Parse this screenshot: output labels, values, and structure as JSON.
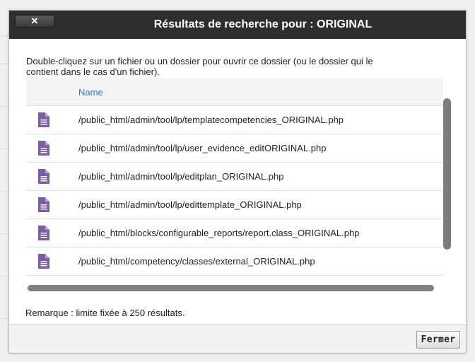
{
  "dialog": {
    "close_label": "✕",
    "title": "Résultats de recherche pour : ORIGINAL",
    "intro_line1": "Double-cliquez sur un fichier ou un dossier pour ouvrir ce dossier (ou le dossier qui le",
    "intro_line2": "contient dans le cas d'un fichier).",
    "table": {
      "column_name": "Name",
      "rows": [
        {
          "icon": "file-document-icon",
          "path": "/public_html/admin/tool/lp/templatecompetencies_ORIGINAL.php"
        },
        {
          "icon": "file-document-icon",
          "path": "/public_html/admin/tool/lp/user_evidence_editORIGINAL.php"
        },
        {
          "icon": "file-document-icon",
          "path": "/public_html/admin/tool/lp/editplan_ORIGINAL.php"
        },
        {
          "icon": "file-document-icon",
          "path": "/public_html/admin/tool/lp/edittemplate_ORIGINAL.php"
        },
        {
          "icon": "file-document-icon",
          "path": "/public_html/blocks/configurable_reports/report.class_ORIGINAL.php"
        },
        {
          "icon": "file-document-icon",
          "path": "/public_html/competency/classes/external_ORIGINAL.php"
        }
      ]
    },
    "remark": "Remarque : limite fixée à 250 résultats.",
    "close_button_label": "Fermer"
  },
  "colors": {
    "titlebar": "#2e2e2e",
    "header_link": "#2a7fc9",
    "file_icon": "#7d5ea6"
  }
}
